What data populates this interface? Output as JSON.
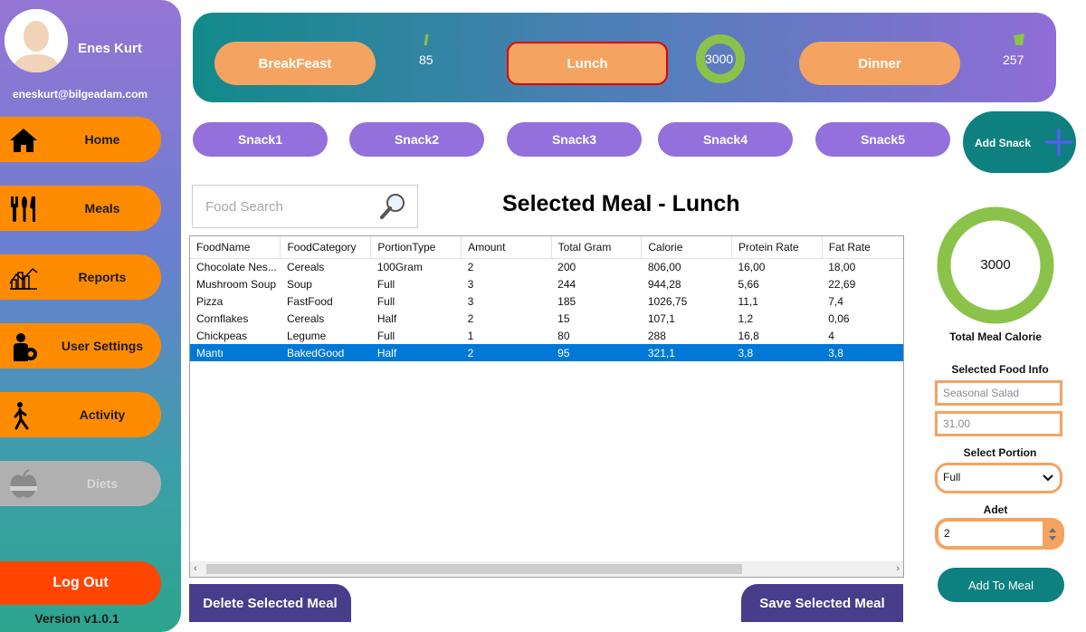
{
  "user": {
    "name": "Enes Kurt",
    "email": "eneskurt@bilgeadam.com"
  },
  "nav": {
    "items": [
      {
        "label": "Home",
        "icon": "home-icon",
        "enabled": true
      },
      {
        "label": "Meals",
        "icon": "utensils-icon",
        "enabled": true
      },
      {
        "label": "Reports",
        "icon": "chart-icon",
        "enabled": true
      },
      {
        "label": "User Settings",
        "icon": "user-gear-icon",
        "enabled": true
      },
      {
        "label": "Activity",
        "icon": "walking-person-icon",
        "enabled": true
      },
      {
        "label": "Diets",
        "icon": "apple-measure-icon",
        "enabled": false
      }
    ],
    "logout_label": "Log Out",
    "version": "Version v1.0.1"
  },
  "meals": {
    "breakfast": {
      "label": "BreakFeast",
      "calorie": "85"
    },
    "lunch": {
      "label": "Lunch",
      "calorie": "3000"
    },
    "dinner": {
      "label": "Dinner",
      "calorie": "257"
    },
    "selected": "Lunch"
  },
  "snacks": {
    "items": [
      "Snack1",
      "Snack2",
      "Snack3",
      "Snack4",
      "Snack5"
    ],
    "add_label": "Add Snack"
  },
  "search": {
    "placeholder": "Food Search"
  },
  "selected_meal_title": "Selected Meal - Lunch",
  "grid": {
    "columns": [
      "FoodName",
      "FoodCategory",
      "PortionType",
      "Amount",
      "Total Gram",
      "Calorie",
      "Protein Rate",
      "Fat Rate"
    ],
    "rows": [
      [
        "Chocolate Nes...",
        "Cereals",
        "100Gram",
        "2",
        "200",
        "806,00",
        "16,00",
        "18,00"
      ],
      [
        "Mushroom Soup",
        "Soup",
        "Full",
        "3",
        "244",
        "944,28",
        "5,66",
        "22,69"
      ],
      [
        "Pizza",
        "FastFood",
        "Full",
        "3",
        "185",
        "1026,75",
        "11,1",
        "7,4"
      ],
      [
        "Cornflakes",
        "Cereals",
        "Half",
        "2",
        "15",
        "107,1",
        "1,2",
        "0,06"
      ],
      [
        "Chickpeas",
        "Legume",
        "Full",
        "1",
        "80",
        "288",
        "16,8",
        "4"
      ],
      [
        "Mantı",
        "BakedGood",
        "Half",
        "2",
        "95",
        "321,1",
        "3,8",
        "3,8"
      ]
    ],
    "selected_row": 5
  },
  "actions": {
    "delete_label": "Delete Selected Meal",
    "save_label": "Save Selected Meal"
  },
  "right_panel": {
    "total_calorie_value": "3000",
    "total_calorie_label": "Total Meal Calorie",
    "food_info_label": "Selected Food Info",
    "food_name_value": "Seasonal Salad",
    "food_value": "31,00",
    "portion_label": "Select Portion",
    "portion_value": "Full",
    "adet_label": "Adet",
    "adet_value": "2",
    "add_to_meal_label": "Add To Meal"
  },
  "colors": {
    "nav_orange": "#ff8c00",
    "meal_orange": "#f4a460",
    "snack_purple": "#9370db",
    "teal": "#0e8080",
    "logout_red": "#ff4500",
    "ring_green": "#8bc34a",
    "selection_blue": "#0078d7"
  }
}
